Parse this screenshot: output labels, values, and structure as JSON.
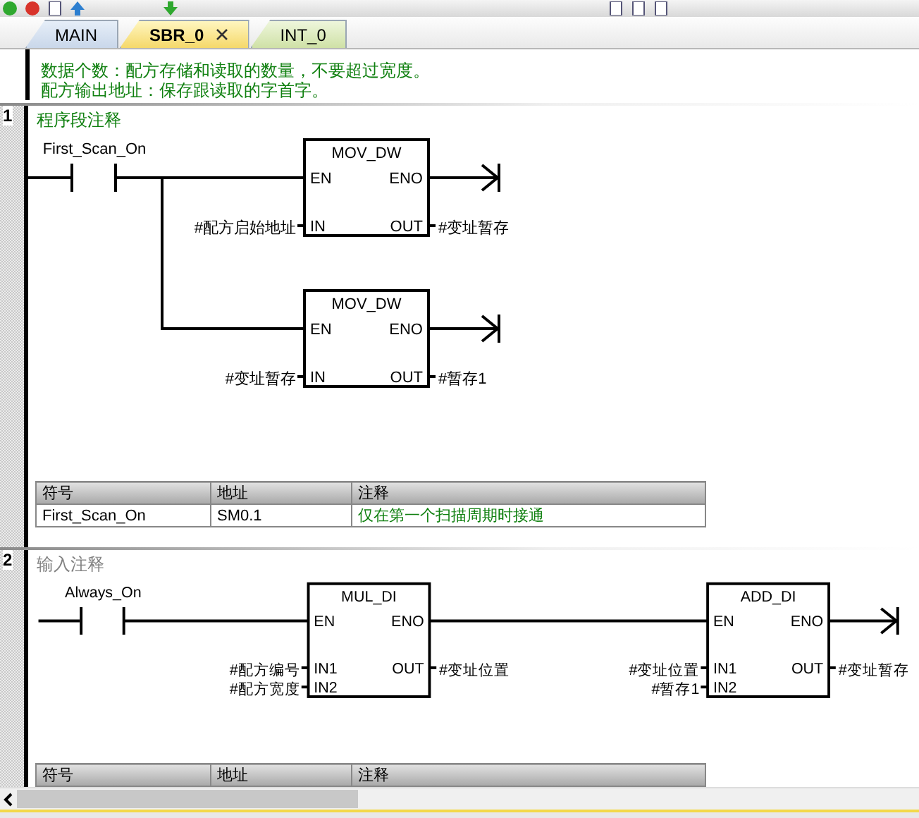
{
  "tabs": [
    {
      "label": "MAIN",
      "selected": false,
      "closable": false
    },
    {
      "label": "SBR_0",
      "selected": true,
      "closable": true
    },
    {
      "label": "INT_0",
      "selected": false,
      "closable": false
    }
  ],
  "comment_lines": [
    "数据个数：配方存储和读取的数量，不要超过宽度。",
    "配方输出地址：保存跟读取的字首字。"
  ],
  "networks": [
    {
      "number": "1",
      "title": "程序段注释",
      "is_placeholder": false,
      "contact": "First_Scan_On",
      "branches": [
        [
          {
            "name": "MOV_DW",
            "en_pin": "EN",
            "eno_pin": "ENO",
            "inputs": [
              {
                "pin": "IN",
                "operand": "#配方启始地址"
              }
            ],
            "outputs": [
              {
                "pin": "OUT",
                "operand": "#变址暂存"
              }
            ]
          }
        ],
        [
          {
            "name": "MOV_DW",
            "en_pin": "EN",
            "eno_pin": "ENO",
            "inputs": [
              {
                "pin": "IN",
                "operand": "#变址暂存"
              }
            ],
            "outputs": [
              {
                "pin": "OUT",
                "operand": "#暂存1"
              }
            ]
          }
        ]
      ],
      "symbol_table": {
        "columns": [
          "符号",
          "地址",
          "注释"
        ],
        "rows": [
          [
            "First_Scan_On",
            "SM0.1",
            "仅在第一个扫描周期时接通"
          ]
        ]
      }
    },
    {
      "number": "2",
      "title": "输入注释",
      "is_placeholder": true,
      "contact": "Always_On",
      "branches": [
        [
          {
            "name": "MUL_DI",
            "en_pin": "EN",
            "eno_pin": "ENO",
            "inputs": [
              {
                "pin": "IN1",
                "operand": "#配方编号"
              },
              {
                "pin": "IN2",
                "operand": "#配方宽度"
              }
            ],
            "outputs": [
              {
                "pin": "OUT",
                "operand": "#变址位置"
              }
            ]
          },
          {
            "name": "ADD_DI",
            "en_pin": "EN",
            "eno_pin": "ENO",
            "inputs": [
              {
                "pin": "IN1",
                "operand": "#变址位置"
              },
              {
                "pin": "IN2",
                "operand": "#暂存1"
              }
            ],
            "outputs": [
              {
                "pin": "OUT",
                "operand": "#变址暂存"
              }
            ]
          }
        ]
      ],
      "symbol_table": {
        "columns": [
          "符号",
          "地址",
          "注释"
        ]
      }
    }
  ]
}
